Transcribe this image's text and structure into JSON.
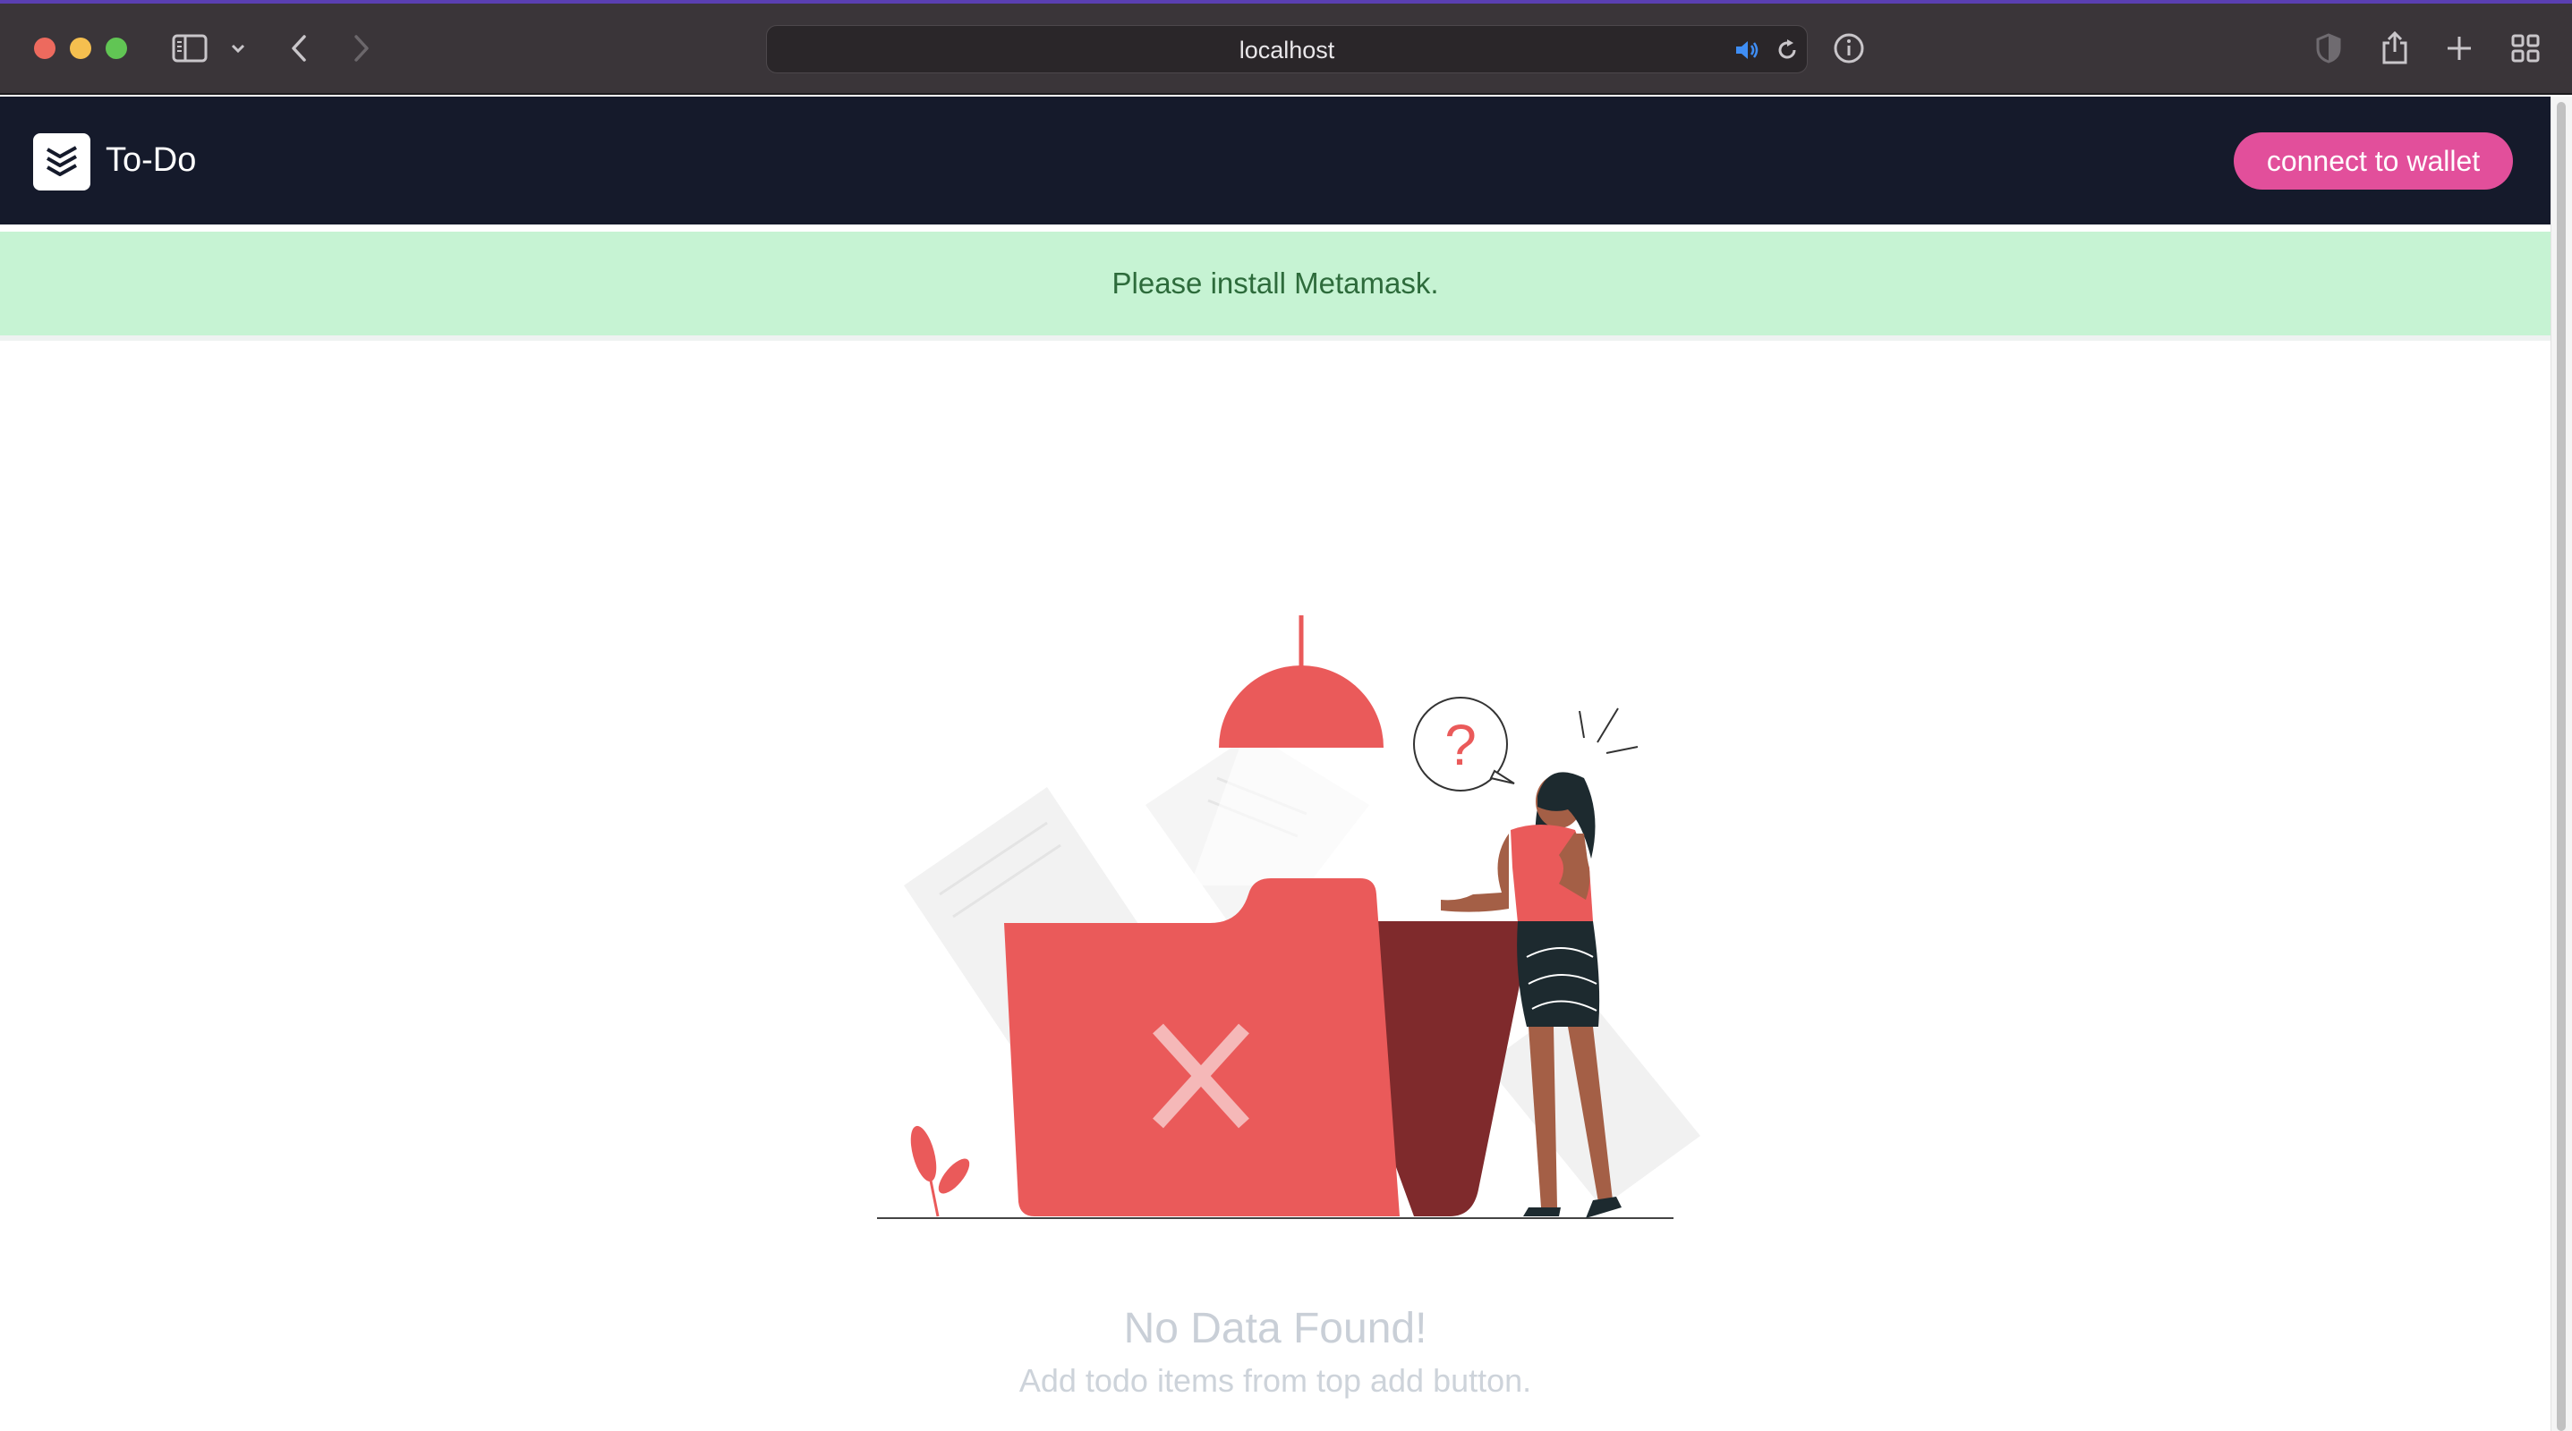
{
  "browser": {
    "url": "localhost",
    "icons": [
      "sidebar-icon",
      "chevron-down-icon",
      "back-icon",
      "forward-icon",
      "speaker-icon",
      "reload-icon",
      "info-icon",
      "shield-icon",
      "share-icon",
      "new-tab-icon",
      "tab-overview-icon"
    ]
  },
  "app": {
    "title": "To-Do",
    "connect_label": "connect to wallet",
    "accent_color": "#e24f9b",
    "header_color": "#151a2b"
  },
  "alert": {
    "message": "Please install Metamask.",
    "color": "#c6f3d3"
  },
  "empty_state": {
    "title": "No Data Found!",
    "subtitle": "Add todo items from top add button."
  }
}
